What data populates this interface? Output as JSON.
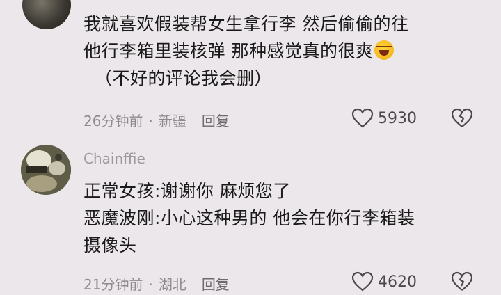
{
  "comments": [
    {
      "username": "",
      "text_lines": [
        "我就喜欢假装帮女生拿行李 然后偷偷的往",
        "他行李箱里装核弹 那种感觉真的很爽",
        "（不好的评论我会删）"
      ],
      "emoji": "laughing-tears-emoji",
      "time": "26分钟前",
      "location": "新疆",
      "reply_label": "回复",
      "likes": "5930"
    },
    {
      "username": "Chainffie",
      "text_lines": [
        "正常女孩:谢谢你  麻烦您了",
        "恶魔波刚:小心这种男的  他会在你行李箱装",
        "摄像头"
      ],
      "time": "21分钟前",
      "location": "湖北",
      "reply_label": "回复",
      "likes": "4620"
    }
  ],
  "colors": {
    "background": "#ece7ea",
    "text": "#1a1a1a",
    "meta": "#8e8a8d"
  }
}
